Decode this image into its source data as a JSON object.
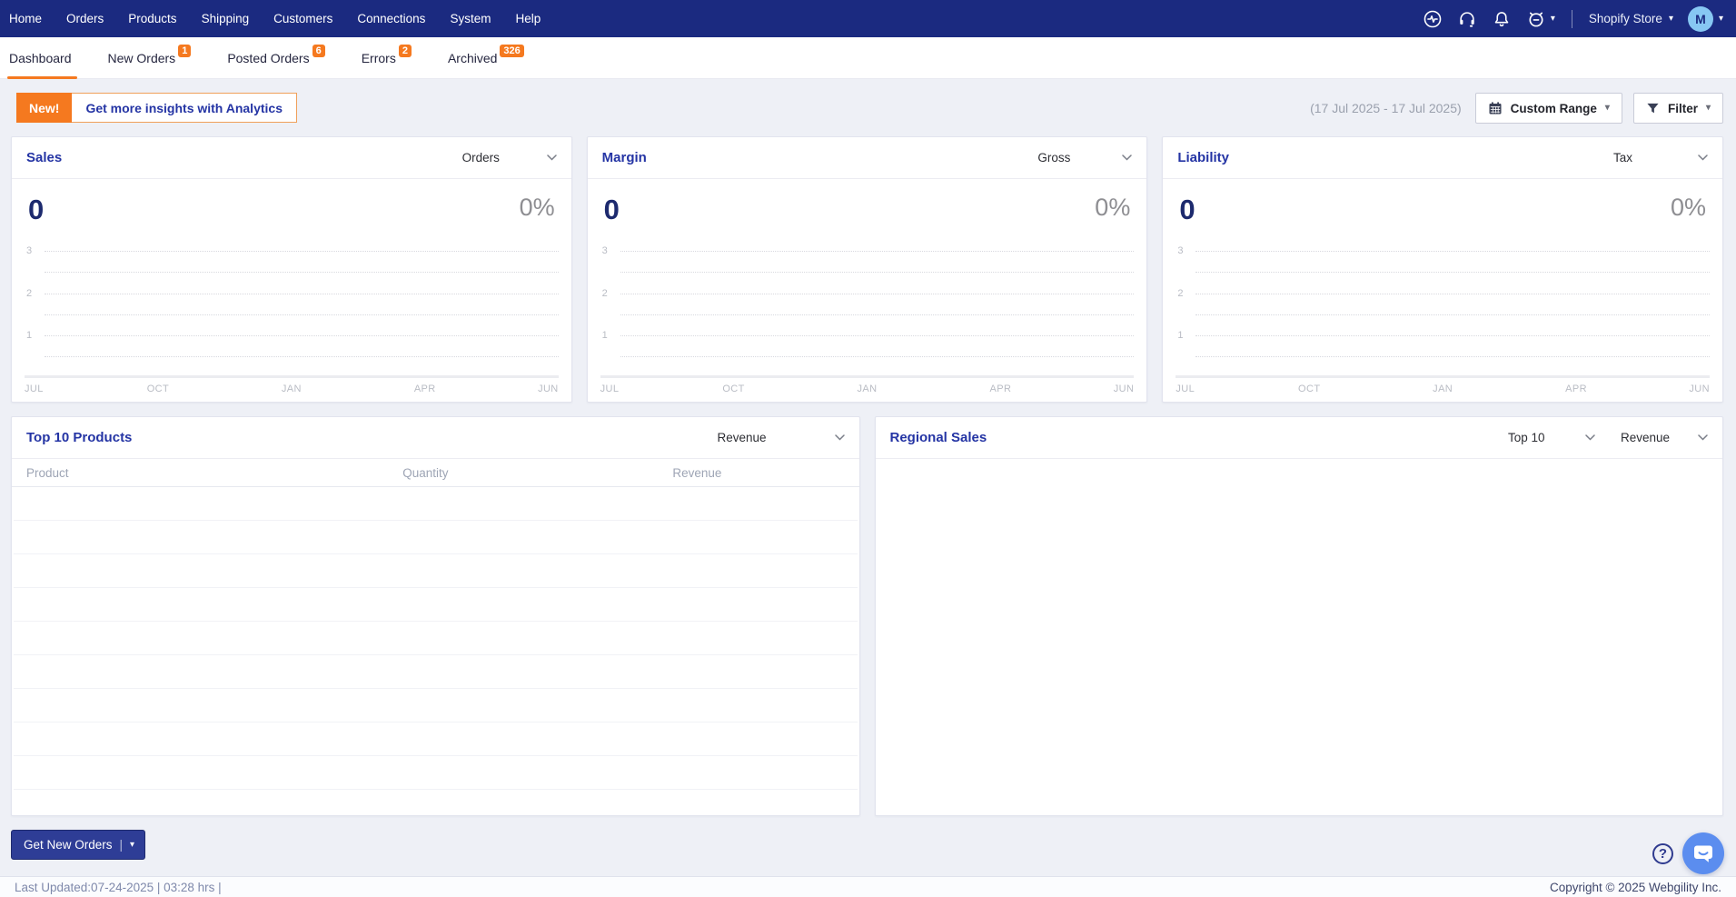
{
  "topnav": {
    "items": [
      "Home",
      "Orders",
      "Products",
      "Shipping",
      "Customers",
      "Connections",
      "System",
      "Help"
    ],
    "icons": [
      "activity-icon",
      "headset-icon",
      "bell-icon",
      "alarm-icon"
    ],
    "store_selector_label": "Shopify Store",
    "avatar_initial": "M"
  },
  "tabs": [
    {
      "label": "Dashboard",
      "active": true
    },
    {
      "label": "New Orders",
      "badge": "1"
    },
    {
      "label": "Posted Orders",
      "badge": "6"
    },
    {
      "label": "Errors",
      "badge": "2"
    },
    {
      "label": "Archived",
      "badge": "326"
    }
  ],
  "toolbar": {
    "new_badge": "New!",
    "analytics_button": "Get more insights with Analytics",
    "date_range": "(17 Jul 2025 - 17 Jul 2025)",
    "range_button": "Custom Range",
    "filter_button": "Filter"
  },
  "stat_cards": [
    {
      "title": "Sales",
      "dropdown": "Orders",
      "value": "0",
      "percent": "0%"
    },
    {
      "title": "Margin",
      "dropdown": "Gross",
      "value": "0",
      "percent": "0%"
    },
    {
      "title": "Liability",
      "dropdown": "Tax",
      "value": "0",
      "percent": "0%"
    }
  ],
  "chart_data": [
    {
      "type": "line",
      "title": "Sales",
      "metric": "Orders",
      "current_value": 0,
      "percent_change": "0%",
      "x_labels": [
        "JUL",
        "OCT",
        "JAN",
        "APR",
        "JUN"
      ],
      "y_ticks": [
        1,
        2,
        3
      ],
      "y_gridlines": [
        3,
        2.5,
        2,
        1.5,
        1,
        0.5
      ],
      "ylim": [
        0,
        3
      ],
      "grid": "dashed-horizontal",
      "legend": "none",
      "series": [
        {
          "name": "Orders",
          "values": []
        }
      ]
    },
    {
      "type": "line",
      "title": "Margin",
      "metric": "Gross",
      "current_value": 0,
      "percent_change": "0%",
      "x_labels": [
        "JUL",
        "OCT",
        "JAN",
        "APR",
        "JUN"
      ],
      "y_ticks": [
        1,
        2,
        3
      ],
      "y_gridlines": [
        3,
        2.5,
        2,
        1.5,
        1,
        0.5
      ],
      "ylim": [
        0,
        3
      ],
      "grid": "dashed-horizontal",
      "legend": "none",
      "series": [
        {
          "name": "Gross",
          "values": []
        }
      ]
    },
    {
      "type": "line",
      "title": "Liability",
      "metric": "Tax",
      "current_value": 0,
      "percent_change": "0%",
      "x_labels": [
        "JUL",
        "OCT",
        "JAN",
        "APR",
        "JUN"
      ],
      "y_ticks": [
        1,
        2,
        3
      ],
      "y_gridlines": [
        3,
        2.5,
        2,
        1.5,
        1,
        0.5
      ],
      "ylim": [
        0,
        3
      ],
      "grid": "dashed-horizontal",
      "legend": "none",
      "series": [
        {
          "name": "Tax",
          "values": []
        }
      ]
    }
  ],
  "products_card": {
    "title": "Top 10 Products",
    "metric_dropdown": "Revenue",
    "columns": [
      "Product",
      "Quantity",
      "Revenue"
    ],
    "rows": []
  },
  "regional_card": {
    "title": "Regional Sales",
    "count_dropdown": "Top 10",
    "metric_dropdown": "Revenue"
  },
  "primary_action": {
    "label": "Get New Orders"
  },
  "footer": {
    "last_updated": "Last Updated:07-24-2025 | 03:28 hrs |",
    "copyright": "Copyright © 2025 Webgility Inc."
  },
  "colors": {
    "navbar": "#1b2a80",
    "accent_orange": "#f5791f",
    "card_title_blue": "#2434a4",
    "value_navy": "#1d2a6e",
    "chat_bubble_blue": "#5b8def",
    "avatar_blue": "#87c7f3"
  }
}
